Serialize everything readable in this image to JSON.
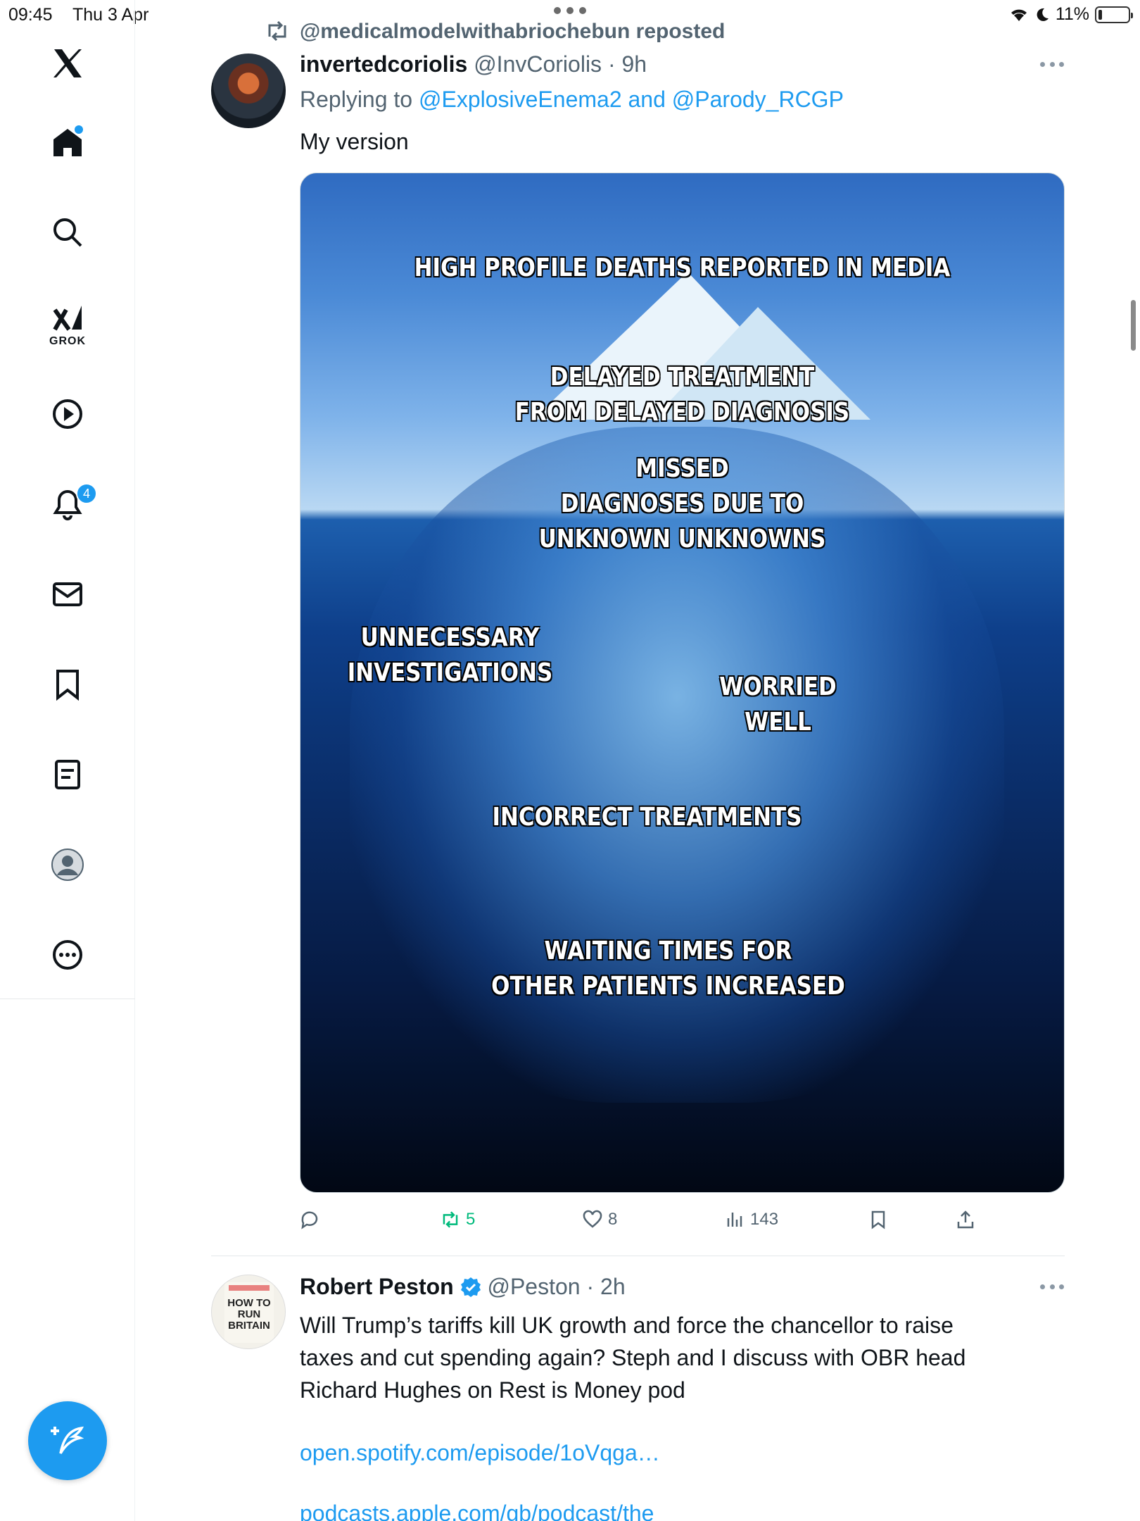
{
  "status_bar": {
    "time": "09:45",
    "date": "Thu 3 Apr",
    "battery": "11%"
  },
  "sidebar": {
    "items": [
      {
        "name": "home",
        "icon": "home-icon",
        "notification_dot": true
      },
      {
        "name": "explore",
        "icon": "search-icon"
      },
      {
        "name": "grok",
        "icon": "grok-icon",
        "label": "GROK"
      },
      {
        "name": "videos",
        "icon": "play-icon"
      },
      {
        "name": "notifications",
        "icon": "bell-icon",
        "badge": "4"
      },
      {
        "name": "messages",
        "icon": "mail-icon"
      },
      {
        "name": "bookmarks",
        "icon": "bookmark-icon"
      },
      {
        "name": "lists",
        "icon": "list-icon"
      },
      {
        "name": "profile",
        "icon": "profile-icon"
      },
      {
        "name": "more",
        "icon": "more-icon"
      }
    ],
    "compose_icon": "compose-icon",
    "accent": "#1d9bf0"
  },
  "tweet1": {
    "repost_label": "@medicalmodelwithabriochebun reposted",
    "display_name": "invertedcoriolis",
    "handle": "@InvCoriolis",
    "time": "9h",
    "replying_prefix": "Replying to",
    "replying_to": "@ExplosiveEnema2 and @Parody_RCGP",
    "text": "My version",
    "image_labels": {
      "l1": "HIGH PROFILE DEATHS REPORTED IN MEDIA",
      "l2a": "DELAYED TREATMENT",
      "l2b": "FROM DELAYED DIAGNOSIS",
      "l3a": "MISSED",
      "l3b": "DIAGNOSES DUE TO",
      "l3c": "UNKNOWN UNKNOWNS",
      "l4a": "UNNECESSARY",
      "l4b": "INVESTIGATIONS",
      "l5a": "WORRIED",
      "l5b": "WELL",
      "l6": "INCORRECT TREATMENTS",
      "l7a": "WAITING TIMES FOR",
      "l7b": "OTHER PATIENTS INCREASED"
    },
    "actions": {
      "replies": "",
      "reposts": "5",
      "likes": "8",
      "views": "143"
    },
    "repost_color": "#00ba7c"
  },
  "tweet2": {
    "display_name": "Robert Peston",
    "verified": true,
    "handle": "@Peston",
    "time": "2h",
    "text_lines": [
      "Will Trump’s tariffs kill UK growth and force the chancellor to raise",
      "taxes and cut spending again? Steph and I discuss with OBR head",
      "Richard Hughes on Rest is Money pod"
    ],
    "link1": "open.spotify.com/episode/1oVqga…",
    "link2": "podcasts.apple.com/gb/podcast/the",
    "avatar_book_lines": [
      "HOW TO",
      "RUN",
      "BRITAIN"
    ]
  }
}
